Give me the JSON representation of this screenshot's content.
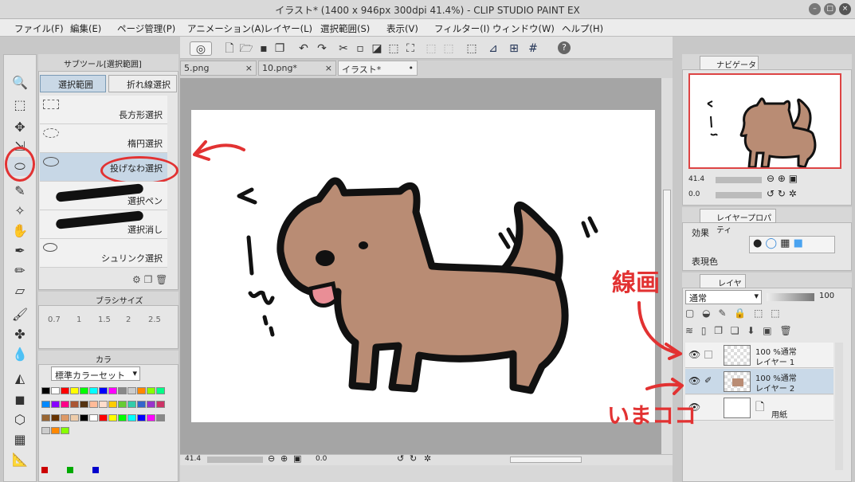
{
  "window": {
    "title": "イラスト* (1400 x 946px 300dpi 41.4%) - CLIP STUDIO PAINT EX",
    "buttons": [
      "–",
      "□",
      "×"
    ]
  },
  "menubar": [
    "ファイル(F)",
    "編集(E)",
    "ページ管理(P)",
    "アニメーション(A)",
    "レイヤー(L)",
    "選択範囲(S)",
    "表示(V)",
    "フィルター(I)",
    "ウィンドウ(W)",
    "ヘルプ(H)"
  ],
  "subtool": {
    "header": "サブツール[選択範囲]",
    "tabs": [
      "選択範囲",
      "折れ線選択"
    ],
    "items": [
      "長方形選択",
      "楕円選択",
      "投げなわ選択",
      "選択ペン",
      "選択消し",
      "シュリンク選択"
    ]
  },
  "brushsize": {
    "header": "ブラシサイズ",
    "values": [
      "0.7",
      "1",
      "1.5",
      "2",
      "2.5"
    ]
  },
  "color": {
    "tab": "カラ",
    "set_name": "標準カラーセット",
    "colors": [
      "#000000",
      "#ffffff",
      "#ff0000",
      "#ffff00",
      "#00ff00",
      "#00ffff",
      "#0000ff",
      "#ff00ff",
      "#888888",
      "#cccccc",
      "#ff8800",
      "#88ff00",
      "#00ff88",
      "#0088ff",
      "#8800ff",
      "#ff0088",
      "#aa5533",
      "#553311",
      "#ffbb99",
      "#ffddcc",
      "#ffcc00",
      "#66cc33",
      "#33ccaa",
      "#3366cc",
      "#9933cc",
      "#cc3366",
      "#996633",
      "#663300",
      "#dd9966",
      "#eeccaa"
    ]
  },
  "canvas": {
    "tabs": [
      "5.png",
      "10.png*",
      "イラスト*"
    ],
    "zoom": "41.4",
    "angle": "0.0",
    "handwriting": "く～ん…"
  },
  "navigator": {
    "tab": "ナビゲーター",
    "zoom": "41.4",
    "angle": "0.0"
  },
  "layer_property": {
    "tab": "レイヤープロパティ",
    "effect_label": "効果",
    "expression_label": "表現色"
  },
  "layers": {
    "tab": "レイヤー",
    "blend_mode": "通常",
    "opacity": "100",
    "items": [
      {
        "mode": "100 %通常",
        "name": "レイヤー 1"
      },
      {
        "mode": "100 %通常",
        "name": "レイヤー 2"
      },
      {
        "mode": "",
        "name": "用紙"
      }
    ]
  },
  "annotations": {
    "line_art": "線画",
    "current": "いまココ"
  },
  "accent": "#e23232"
}
